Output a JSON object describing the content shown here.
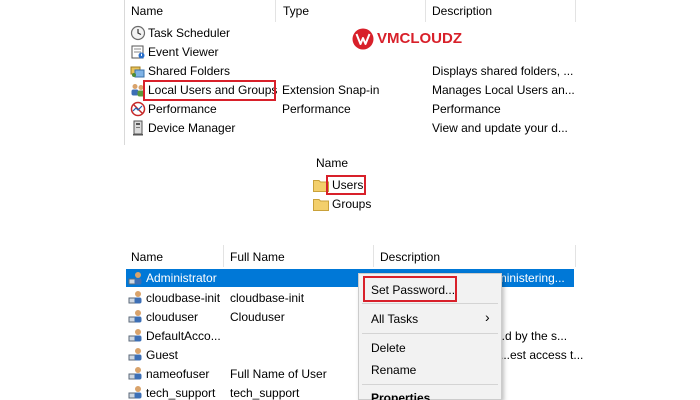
{
  "brand": {
    "logo_text": "VMCLOUDZ",
    "color": "#d8202a"
  },
  "snapins": {
    "columns": [
      "Name",
      "Type",
      "Description"
    ],
    "rows": [
      {
        "name": "Task Scheduler",
        "type": "",
        "description": "",
        "icon": "clock-icon"
      },
      {
        "name": "Event Viewer",
        "type": "",
        "description": "",
        "icon": "event-viewer-icon"
      },
      {
        "name": "Shared Folders",
        "type": "",
        "description": "Displays shared folders, ...",
        "icon": "shared-folders-icon"
      },
      {
        "name": "Local Users and Groups",
        "type": "Extension Snap-in",
        "description": "Manages Local Users an...",
        "icon": "users-group-icon"
      },
      {
        "name": "Performance",
        "type": "Performance",
        "description": "Performance",
        "icon": "performance-icon"
      },
      {
        "name": "Device Manager",
        "type": "",
        "description": "View and update your d...",
        "icon": "device-manager-icon"
      }
    ]
  },
  "folders": {
    "column": "Name",
    "items": [
      {
        "name": "Users",
        "icon": "folder-icon"
      },
      {
        "name": "Groups",
        "icon": "folder-icon"
      }
    ]
  },
  "users": {
    "columns": [
      "Name",
      "Full Name",
      "Description"
    ],
    "rows": [
      {
        "name": "Administrator",
        "full_name": "",
        "description": "B...lt-in account for administering...",
        "selected": true
      },
      {
        "name": "cloudbase-init",
        "full_name": "cloudbase-init",
        "description": ""
      },
      {
        "name": "clouduser",
        "full_name": "Clouduser",
        "description": ""
      },
      {
        "name": "DefaultAcco...",
        "full_name": "",
        "description": "...d by the s..."
      },
      {
        "name": "Guest",
        "full_name": "",
        "description": "...est access t..."
      },
      {
        "name": "nameofuser",
        "full_name": "Full Name of User",
        "description": ""
      },
      {
        "name": "tech_support",
        "full_name": "tech_support",
        "description": ""
      }
    ]
  },
  "context_menu": {
    "items": [
      "Set Password...",
      "All Tasks",
      "Delete",
      "Rename",
      "Properties"
    ],
    "submenu_arrow": "›"
  },
  "colors": {
    "selection": "#0078d7",
    "highlight_box": "#d8202a"
  }
}
